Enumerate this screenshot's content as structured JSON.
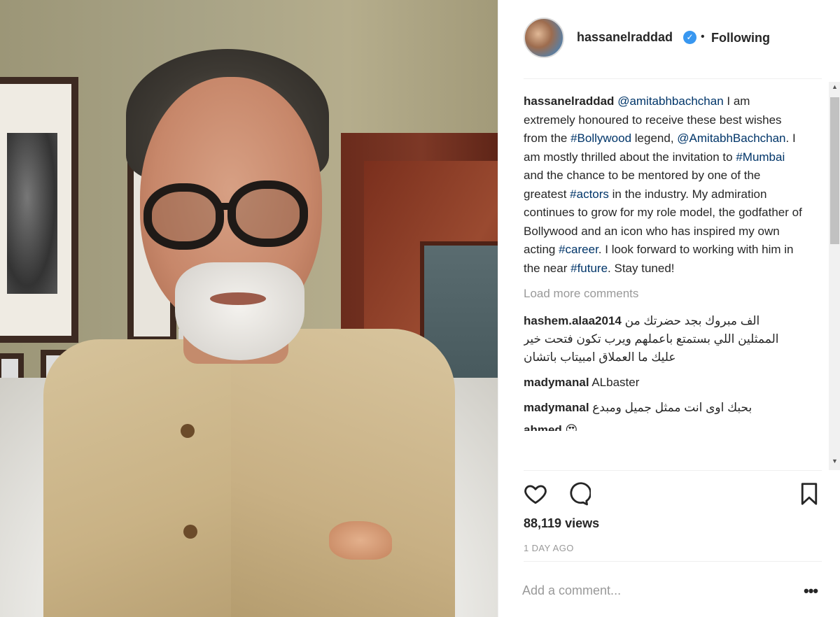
{
  "post": {
    "username": "hassanelraddad",
    "verified_mark": "✓",
    "separator": "•",
    "follow_status": "Following"
  },
  "caption": {
    "username": "hassanelraddad",
    "parts": [
      {
        "text": "@amitabhbachchan",
        "tag": true
      },
      {
        "text": " I am extremely honoured to receive these best wishes from the ",
        "tag": false
      },
      {
        "text": "#Bollywood",
        "tag": true
      },
      {
        "text": " legend, ",
        "tag": false
      },
      {
        "text": "@AmitabhBachchan",
        "tag": true
      },
      {
        "text": ". I am mostly thrilled about the invitation to ",
        "tag": false
      },
      {
        "text": "#Mumbai",
        "tag": true
      },
      {
        "text": " and the chance to be mentored by one of the greatest ",
        "tag": false
      },
      {
        "text": "#actors",
        "tag": true
      },
      {
        "text": " in the industry. My admiration continues to grow for my role model, the godfather of Bollywood and an icon who has inspired my own acting ",
        "tag": false
      },
      {
        "text": "#career",
        "tag": true
      },
      {
        "text": ". I look forward to working with him in the near ",
        "tag": false
      },
      {
        "text": "#future",
        "tag": true
      },
      {
        "text": ". Stay tuned!",
        "tag": false
      }
    ]
  },
  "load_more": "Load more comments",
  "comments": [
    {
      "user": "hashem.alaa2014",
      "text": "الف مبروك بجد حضرتك من الممثلين اللي بستمتع باعملهم ويرب تكون فتحت خير عليك ما العملاق امبيتاب باتشان"
    },
    {
      "user": "madymanal",
      "text": "ALbaster"
    },
    {
      "user": "madymanal",
      "text": "بحبك اوى انت ممثل جميل ومبدع"
    },
    {
      "user": "ahmed",
      "text": "😍"
    }
  ],
  "stats": {
    "views": "88,119 views",
    "time": "1 DAY AGO"
  },
  "input": {
    "placeholder": "Add a comment..."
  },
  "more_label": "•••",
  "icons": {
    "like": "heart-icon",
    "comment": "comment-icon",
    "save": "bookmark-icon",
    "verified": "verified-badge-icon"
  },
  "colors": {
    "link": "#003569",
    "verified": "#3897f0",
    "muted": "#999999"
  }
}
